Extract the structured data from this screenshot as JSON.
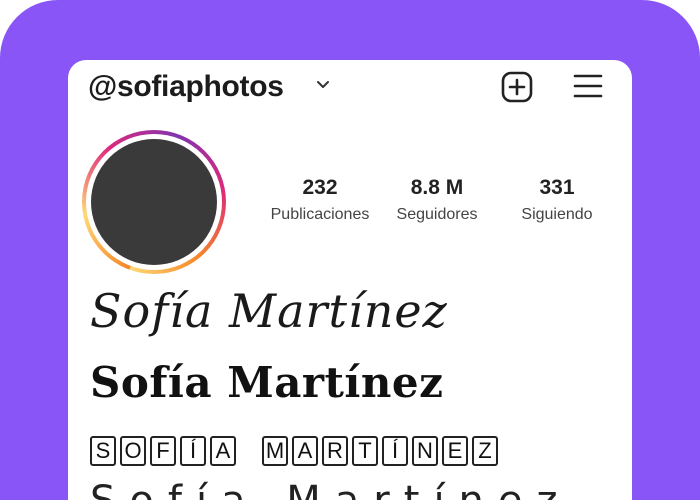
{
  "profile": {
    "username": "@sofiaphotos",
    "icons": {
      "dropdown": "chevron-down-icon",
      "add": "plus-square-icon",
      "menu": "hamburger-menu-icon"
    },
    "colors": {
      "frame": "#8a55f7",
      "avatar": "#3a3a3a",
      "story_ring": [
        "#f58529",
        "#feda77",
        "#dd2a7b",
        "#8134af"
      ]
    }
  },
  "stats": {
    "posts": {
      "value": "232",
      "label": "Publicaciones"
    },
    "followers": {
      "value": "8.8 M",
      "label": "Seguidores"
    },
    "following": {
      "value": "331",
      "label": "Siguiendo"
    }
  },
  "name_styles": {
    "script": "Sofía Martínez",
    "gothic": "Sofía Martínez",
    "boxed": [
      "S",
      "O",
      "F",
      "Í",
      "A",
      " ",
      "M",
      "A",
      "R",
      "T",
      "Í",
      "N",
      "E",
      "Z"
    ],
    "spaced": "Sofía Martínez"
  }
}
